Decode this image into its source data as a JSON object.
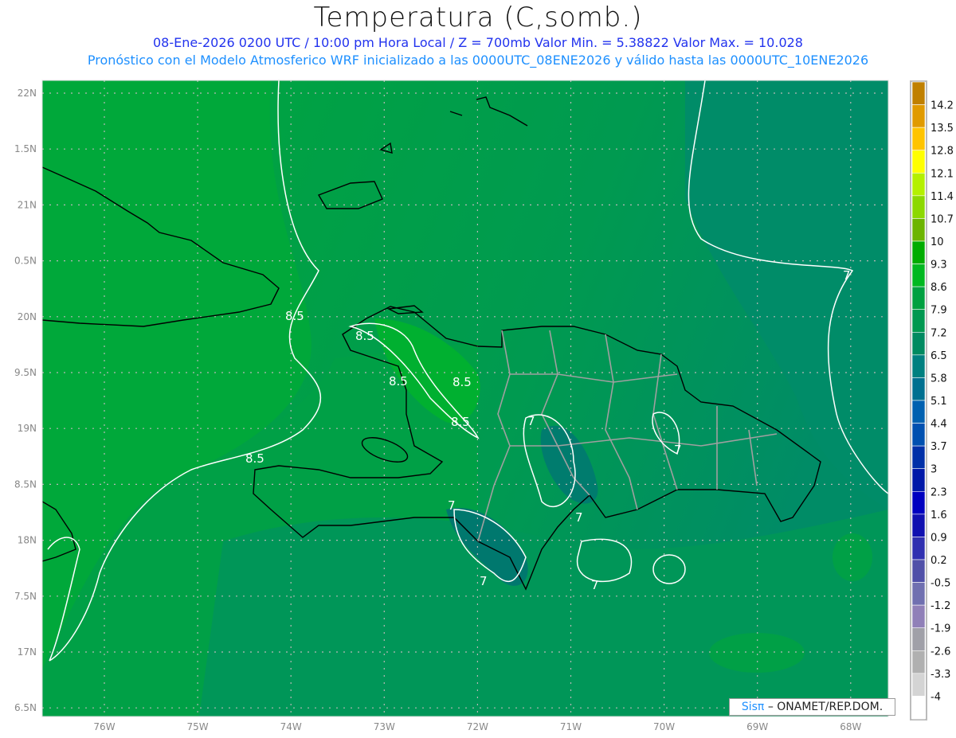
{
  "header": {
    "title": "Temperatura (C,somb.)",
    "line1": "08-Ene-2026  0200 UTC / 10:00 pm Hora Local / Z = 700mb    Valor Min. = 5.38822  Valor Max. = 10.028",
    "line2": "Pronóstico con el Modelo Atmosferico WRF inicializado a las 0000UTC_08ENE2026 y válido hasta las  0000UTC_10ENE2026"
  },
  "map": {
    "lat_labels": [
      "22N",
      "1.5N",
      "21N",
      "0.5N",
      "20N",
      "9.5N",
      "19N",
      "8.5N",
      "18N",
      "7.5N",
      "17N",
      "6.5N"
    ],
    "lon_labels": [
      "76W",
      "75W",
      "74W",
      "73W",
      "72W",
      "71W",
      "70W",
      "69W",
      "68W"
    ],
    "contour_labels": [
      "8.5",
      "8.5",
      "8.5",
      "8.5",
      "8.5",
      "8.5",
      "7",
      "7",
      "7",
      "7",
      "7",
      "7",
      "7"
    ],
    "colors": {
      "warm_green": "#00a83c",
      "mid_green": "#00a046",
      "sea_green": "#009658",
      "teal": "#00886a",
      "coast": "#000000",
      "borders": "#a0a0a0",
      "contour": "#ffffff"
    }
  },
  "colorbar": {
    "labels": [
      "14.2",
      "13.5",
      "12.8",
      "12.1",
      "11.4",
      "10.7",
      "10",
      "9.3",
      "8.6",
      "7.9",
      "7.2",
      "6.5",
      "5.8",
      "5.1",
      "4.4",
      "3.7",
      "3",
      "2.3",
      "1.6",
      "0.9",
      "0.2",
      "-0.5",
      "-1.2",
      "-1.9",
      "-2.6",
      "-3.3",
      "-4"
    ],
    "colors": [
      "#c08000",
      "#e09a00",
      "#ffc400",
      "#ffff00",
      "#b4f000",
      "#8cd800",
      "#6cb400",
      "#00ac00",
      "#00b820",
      "#00a040",
      "#009850",
      "#008a60",
      "#008080",
      "#007090",
      "#0060b0",
      "#0050b0",
      "#0030a8",
      "#0018a8",
      "#0000c0",
      "#1010b0",
      "#3030b0",
      "#5050a8",
      "#7070b0",
      "#9080b8",
      "#a0a0a8",
      "#b0b0b0",
      "#d4d4d4",
      "#ffffff"
    ]
  },
  "credit": {
    "logo": "Sisπ",
    "text": "– ONAMET/REP.DOM."
  }
}
